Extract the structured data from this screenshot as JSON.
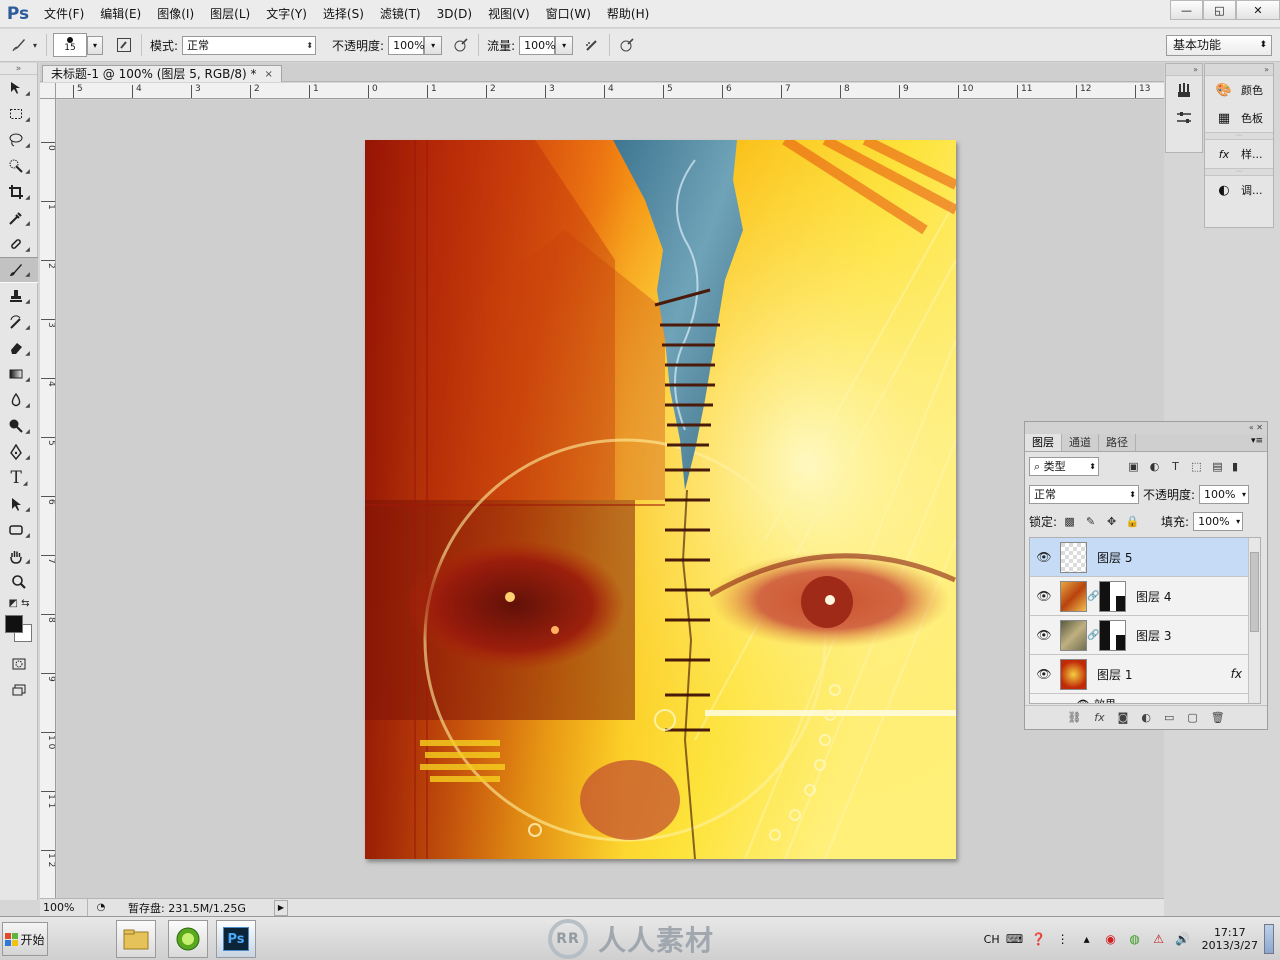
{
  "app": {
    "logo": "Ps"
  },
  "menu": [
    "文件(F)",
    "编辑(E)",
    "图像(I)",
    "图层(L)",
    "文字(Y)",
    "选择(S)",
    "滤镜(T)",
    "3D(D)",
    "视图(V)",
    "窗口(W)",
    "帮助(H)"
  ],
  "window_controls": {
    "minimize": "—",
    "restore": "◱",
    "close": "✕"
  },
  "options": {
    "brush_size": "15",
    "mode_label": "模式:",
    "mode_value": "正常",
    "opacity_label": "不透明度:",
    "opacity_value": "100%",
    "flow_label": "流量:",
    "flow_value": "100%",
    "workspace": "基本功能"
  },
  "document": {
    "tab_title": "未标题-1 @ 100% (图层 5, RGB/8) *",
    "close": "×"
  },
  "ruler_top": [
    "5",
    "4",
    "3",
    "2",
    "1",
    "0",
    "1",
    "2",
    "3",
    "4",
    "5",
    "6",
    "7",
    "8",
    "9",
    "10",
    "11",
    "12",
    "13"
  ],
  "ruler_left": [
    "0",
    "1",
    "2",
    "3",
    "4",
    "5",
    "6",
    "7",
    "8",
    "9",
    "1 0",
    "1 1",
    "1 2"
  ],
  "status": {
    "zoom": "100%",
    "scratch": "暂存盘: 231.5M/1.25G"
  },
  "dock": {
    "color_label": "颜色",
    "swatches_label": "色板",
    "styles_label": "样...",
    "adjust_label": "调..."
  },
  "layers_panel": {
    "tabs": [
      "图层",
      "通道",
      "路径"
    ],
    "filter_kind": "类型",
    "blend_mode": "正常",
    "opacity_label": "不透明度:",
    "opacity_value": "100%",
    "lock_label": "锁定:",
    "fill_label": "填充:",
    "fill_value": "100%",
    "layers": [
      {
        "name": "图层 5",
        "selected": true
      },
      {
        "name": "图层 4",
        "selected": false
      },
      {
        "name": "图层 3",
        "selected": false
      },
      {
        "name": "图层 1",
        "selected": false
      }
    ],
    "effects_label": "效果",
    "fx_label": "fx"
  },
  "taskbar": {
    "start": "开始",
    "watermark": "人人素材",
    "lang": "CH",
    "time": "17:17",
    "date": "2013/3/27"
  },
  "colors": {
    "foreground": "#111111",
    "background": "#ffffff",
    "selection": "#c6dcf6"
  }
}
